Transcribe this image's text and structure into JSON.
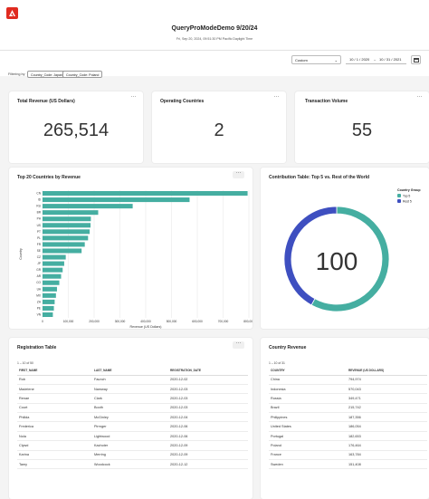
{
  "header": {
    "logo": "adobe-logo",
    "title": "QueryProModeDemo 9/20/24",
    "subtitle": "Fri, Sep 20, 2024, 09:51:30 PM Pacific Daylight Time"
  },
  "date_controls": {
    "range_type": "Custom",
    "start_date": "10 / 1 / 2020",
    "end_date": "10 / 31 / 2021",
    "separator": "–",
    "calendar_icon": "calendar-icon"
  },
  "filters": {
    "label": "Filtering by",
    "chips": [
      "Country_Code: Japan",
      "Country_Code: Poland"
    ]
  },
  "more_label": "···",
  "kpis": [
    {
      "title": "Total Revenue (US Dollars)",
      "value": "265,514"
    },
    {
      "title": "Operating Countries",
      "value": "2"
    },
    {
      "title": "Transaction Volume",
      "value": "55"
    }
  ],
  "bar_card_title": "Top 20 Countries by Revenue",
  "donut_card_title": "Contribution Table: Top 5 vs. Rest of the World",
  "reg_table": {
    "title": "Registration Table",
    "rowcount": "1 – 10 of 50",
    "columns": [
      "FIRST_NAME",
      "LAST_NAME",
      "REGISTRATION_DATE"
    ],
    "rows": [
      [
        "Rob",
        "Faunch",
        "2020-12-02"
      ],
      [
        "Madelene",
        "Namway",
        "2020-12-03"
      ],
      [
        "Renae",
        "Clark",
        "2020-12-03"
      ],
      [
        "Court",
        "Booth",
        "2020-12-03"
      ],
      [
        "Philida",
        "McGinley",
        "2020-12-04"
      ],
      [
        "Frederica",
        "Pirrnger",
        "2020-12-06"
      ],
      [
        "Nola",
        "Lightwood",
        "2020-12-06"
      ],
      [
        "Clywd",
        "Kachoter",
        "2020-12-09"
      ],
      [
        "Karina",
        "Merring",
        "2020-12-09"
      ],
      [
        "Tamy",
        "Woodcock",
        "2020-12-12"
      ]
    ]
  },
  "country_table": {
    "title": "Country Revenue",
    "rowcount": "1 – 10 of 31",
    "columns": [
      "COUNTRY",
      "REVENUE (US DOLLARS)"
    ],
    "rows": [
      [
        "China",
        "794,974"
      ],
      [
        "Indonesia",
        "570,043"
      ],
      [
        "Russia",
        "349,471"
      ],
      [
        "Brazil",
        "215,742"
      ],
      [
        "Philippines",
        "187,356"
      ],
      [
        "United States",
        "186,054"
      ],
      [
        "Portugal",
        "182,653"
      ],
      [
        "Poland",
        "176,464"
      ],
      [
        "France",
        "163,784"
      ],
      [
        "Sweden",
        "151,408"
      ]
    ]
  },
  "chart_data": [
    {
      "type": "bar",
      "orientation": "horizontal",
      "title": "Top 20 Countries by Revenue",
      "xlabel": "Revenue (US Dollars)",
      "ylabel": "Country",
      "xlim": [
        0,
        800000
      ],
      "xticks": [
        "0",
        "100,000",
        "200,000",
        "300,000",
        "400,000",
        "500,000",
        "600,000",
        "700,000",
        "800,000"
      ],
      "grid": true,
      "color": "#45aea1",
      "categories": [
        "CN",
        "ID",
        "RU",
        "BR",
        "PH",
        "US",
        "PT",
        "PL",
        "FR",
        "SE",
        "CZ",
        "JP",
        "GR",
        "AR",
        "CO",
        "UA",
        "MX",
        "ZA",
        "PE",
        "VN"
      ],
      "values": [
        794974,
        570043,
        349471,
        215742,
        187356,
        186054,
        182653,
        176464,
        163784,
        151408,
        90000,
        84000,
        78000,
        72000,
        65000,
        56000,
        52000,
        47000,
        44000,
        40000
      ]
    },
    {
      "type": "pie",
      "style": "donut",
      "title": "Contribution Table: Top 5 vs. Rest of the World",
      "legend_title": "Country Group",
      "legend_position": "top-right",
      "center_label": "100",
      "slices": [
        {
          "name": "Top 5",
          "value": 58,
          "color": "#45aea1"
        },
        {
          "name": "Rest 5",
          "value": 42,
          "color": "#3e4fc0"
        }
      ]
    }
  ]
}
